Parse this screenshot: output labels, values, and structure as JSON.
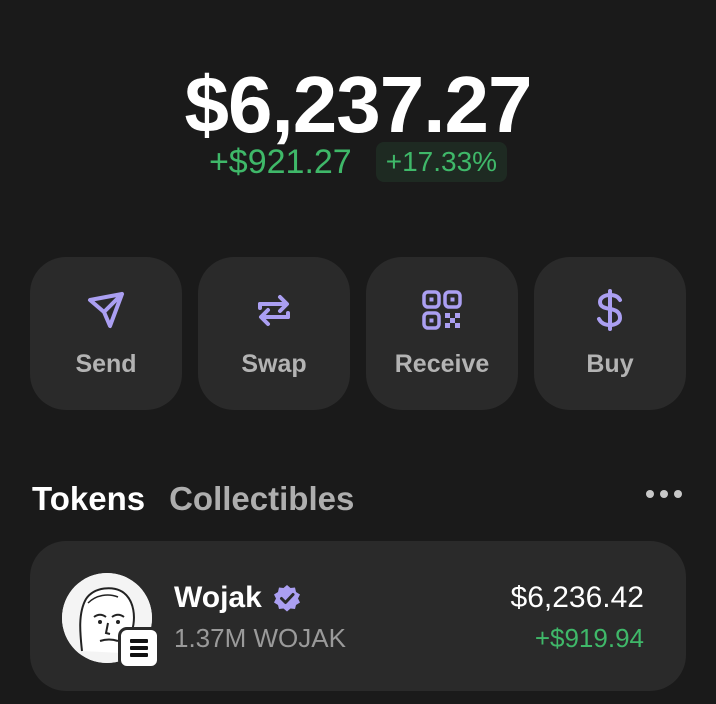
{
  "balance": {
    "total": "$6,237.27",
    "change_abs": "+$921.27",
    "change_pct": "+17.33%"
  },
  "colors": {
    "background": "#1a1a1a",
    "card": "#2a2a2a",
    "accent_purple": "#ab9ff2",
    "positive_green": "#3fb869"
  },
  "actions": [
    {
      "label": "Send",
      "icon": "send-icon"
    },
    {
      "label": "Swap",
      "icon": "swap-icon"
    },
    {
      "label": "Receive",
      "icon": "qr-code-icon"
    },
    {
      "label": "Buy",
      "icon": "dollar-icon"
    }
  ],
  "tabs": {
    "tokens": "Tokens",
    "collectibles": "Collectibles",
    "more_icon": "more-horizontal-icon"
  },
  "token": {
    "name": "Wojak",
    "verified_icon": "verified-badge-icon",
    "amount": "1.37M WOJAK",
    "value": "$6,236.42",
    "change": "+$919.94",
    "chain_icon": "solana-icon"
  }
}
